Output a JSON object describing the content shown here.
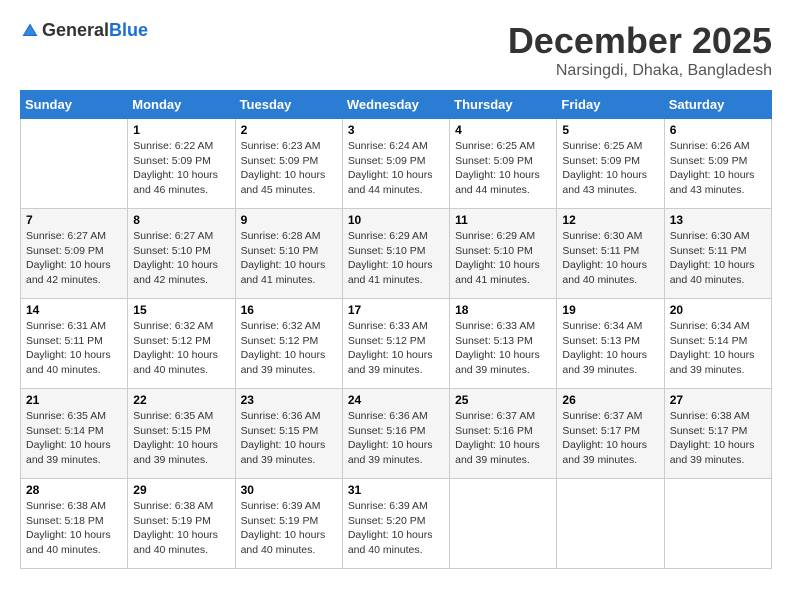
{
  "logo": {
    "general": "General",
    "blue": "Blue"
  },
  "title": {
    "month_year": "December 2025",
    "location": "Narsingdi, Dhaka, Bangladesh"
  },
  "header": {
    "days": [
      "Sunday",
      "Monday",
      "Tuesday",
      "Wednesday",
      "Thursday",
      "Friday",
      "Saturday"
    ]
  },
  "weeks": [
    {
      "cells": [
        {
          "day": "",
          "info": ""
        },
        {
          "day": "1",
          "info": "Sunrise: 6:22 AM\nSunset: 5:09 PM\nDaylight: 10 hours\nand 46 minutes."
        },
        {
          "day": "2",
          "info": "Sunrise: 6:23 AM\nSunset: 5:09 PM\nDaylight: 10 hours\nand 45 minutes."
        },
        {
          "day": "3",
          "info": "Sunrise: 6:24 AM\nSunset: 5:09 PM\nDaylight: 10 hours\nand 44 minutes."
        },
        {
          "day": "4",
          "info": "Sunrise: 6:25 AM\nSunset: 5:09 PM\nDaylight: 10 hours\nand 44 minutes."
        },
        {
          "day": "5",
          "info": "Sunrise: 6:25 AM\nSunset: 5:09 PM\nDaylight: 10 hours\nand 43 minutes."
        },
        {
          "day": "6",
          "info": "Sunrise: 6:26 AM\nSunset: 5:09 PM\nDaylight: 10 hours\nand 43 minutes."
        }
      ]
    },
    {
      "cells": [
        {
          "day": "7",
          "info": "Sunrise: 6:27 AM\nSunset: 5:09 PM\nDaylight: 10 hours\nand 42 minutes."
        },
        {
          "day": "8",
          "info": "Sunrise: 6:27 AM\nSunset: 5:10 PM\nDaylight: 10 hours\nand 42 minutes."
        },
        {
          "day": "9",
          "info": "Sunrise: 6:28 AM\nSunset: 5:10 PM\nDaylight: 10 hours\nand 41 minutes."
        },
        {
          "day": "10",
          "info": "Sunrise: 6:29 AM\nSunset: 5:10 PM\nDaylight: 10 hours\nand 41 minutes."
        },
        {
          "day": "11",
          "info": "Sunrise: 6:29 AM\nSunset: 5:10 PM\nDaylight: 10 hours\nand 41 minutes."
        },
        {
          "day": "12",
          "info": "Sunrise: 6:30 AM\nSunset: 5:11 PM\nDaylight: 10 hours\nand 40 minutes."
        },
        {
          "day": "13",
          "info": "Sunrise: 6:30 AM\nSunset: 5:11 PM\nDaylight: 10 hours\nand 40 minutes."
        }
      ]
    },
    {
      "cells": [
        {
          "day": "14",
          "info": "Sunrise: 6:31 AM\nSunset: 5:11 PM\nDaylight: 10 hours\nand 40 minutes."
        },
        {
          "day": "15",
          "info": "Sunrise: 6:32 AM\nSunset: 5:12 PM\nDaylight: 10 hours\nand 40 minutes."
        },
        {
          "day": "16",
          "info": "Sunrise: 6:32 AM\nSunset: 5:12 PM\nDaylight: 10 hours\nand 39 minutes."
        },
        {
          "day": "17",
          "info": "Sunrise: 6:33 AM\nSunset: 5:12 PM\nDaylight: 10 hours\nand 39 minutes."
        },
        {
          "day": "18",
          "info": "Sunrise: 6:33 AM\nSunset: 5:13 PM\nDaylight: 10 hours\nand 39 minutes."
        },
        {
          "day": "19",
          "info": "Sunrise: 6:34 AM\nSunset: 5:13 PM\nDaylight: 10 hours\nand 39 minutes."
        },
        {
          "day": "20",
          "info": "Sunrise: 6:34 AM\nSunset: 5:14 PM\nDaylight: 10 hours\nand 39 minutes."
        }
      ]
    },
    {
      "cells": [
        {
          "day": "21",
          "info": "Sunrise: 6:35 AM\nSunset: 5:14 PM\nDaylight: 10 hours\nand 39 minutes."
        },
        {
          "day": "22",
          "info": "Sunrise: 6:35 AM\nSunset: 5:15 PM\nDaylight: 10 hours\nand 39 minutes."
        },
        {
          "day": "23",
          "info": "Sunrise: 6:36 AM\nSunset: 5:15 PM\nDaylight: 10 hours\nand 39 minutes."
        },
        {
          "day": "24",
          "info": "Sunrise: 6:36 AM\nSunset: 5:16 PM\nDaylight: 10 hours\nand 39 minutes."
        },
        {
          "day": "25",
          "info": "Sunrise: 6:37 AM\nSunset: 5:16 PM\nDaylight: 10 hours\nand 39 minutes."
        },
        {
          "day": "26",
          "info": "Sunrise: 6:37 AM\nSunset: 5:17 PM\nDaylight: 10 hours\nand 39 minutes."
        },
        {
          "day": "27",
          "info": "Sunrise: 6:38 AM\nSunset: 5:17 PM\nDaylight: 10 hours\nand 39 minutes."
        }
      ]
    },
    {
      "cells": [
        {
          "day": "28",
          "info": "Sunrise: 6:38 AM\nSunset: 5:18 PM\nDaylight: 10 hours\nand 40 minutes."
        },
        {
          "day": "29",
          "info": "Sunrise: 6:38 AM\nSunset: 5:19 PM\nDaylight: 10 hours\nand 40 minutes."
        },
        {
          "day": "30",
          "info": "Sunrise: 6:39 AM\nSunset: 5:19 PM\nDaylight: 10 hours\nand 40 minutes."
        },
        {
          "day": "31",
          "info": "Sunrise: 6:39 AM\nSunset: 5:20 PM\nDaylight: 10 hours\nand 40 minutes."
        },
        {
          "day": "",
          "info": ""
        },
        {
          "day": "",
          "info": ""
        },
        {
          "day": "",
          "info": ""
        }
      ]
    }
  ]
}
